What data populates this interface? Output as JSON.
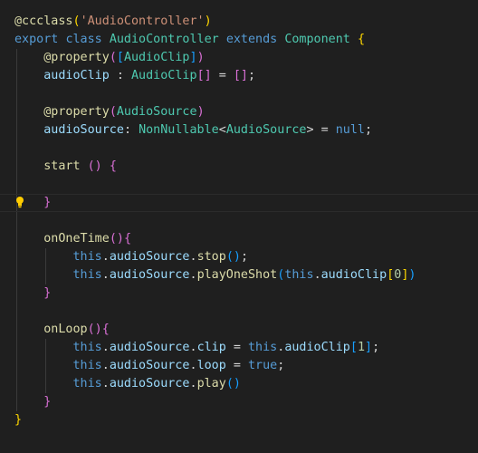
{
  "editor": {
    "colors": {
      "background": "#1f1f1f",
      "keyword": "#569cd6",
      "type": "#4ec9b0",
      "function": "#dcdcaa",
      "variable": "#9cdcfe",
      "string": "#ce9178",
      "number": "#b5cea8",
      "bracket_level1": "#ffd700",
      "bracket_level2": "#da70d6",
      "bracket_level3": "#179fff"
    },
    "lightbulb_icon": "lightbulb-icon",
    "lines": [
      [
        [
          "@ccclass",
          "fn"
        ],
        [
          "(",
          "p1"
        ],
        [
          "'AudioController'",
          "str"
        ],
        [
          ")",
          "p1"
        ]
      ],
      [
        [
          "export ",
          "kw"
        ],
        [
          "class ",
          "kw"
        ],
        [
          "AudioController ",
          "cls"
        ],
        [
          "extends ",
          "kw"
        ],
        [
          "Component ",
          "cls"
        ],
        [
          "{",
          "p1"
        ]
      ],
      [
        [
          "    ",
          "op"
        ],
        [
          "@property",
          "fn"
        ],
        [
          "(",
          "p2"
        ],
        [
          "[",
          "p3"
        ],
        [
          "AudioClip",
          "cls"
        ],
        [
          "]",
          "p3"
        ],
        [
          ")",
          "p2"
        ]
      ],
      [
        [
          "    ",
          "op"
        ],
        [
          "audioClip",
          "var"
        ],
        [
          " : ",
          "op"
        ],
        [
          "AudioClip",
          "cls"
        ],
        [
          "[]",
          "p2"
        ],
        [
          " = ",
          "op"
        ],
        [
          "[]",
          "p2"
        ],
        [
          ";",
          "op"
        ]
      ],
      [],
      [
        [
          "    ",
          "op"
        ],
        [
          "@property",
          "fn"
        ],
        [
          "(",
          "p2"
        ],
        [
          "AudioSource",
          "cls"
        ],
        [
          ")",
          "p2"
        ]
      ],
      [
        [
          "    ",
          "op"
        ],
        [
          "audioSource",
          "var"
        ],
        [
          ": ",
          "op"
        ],
        [
          "NonNullable",
          "cls"
        ],
        [
          "<",
          "op"
        ],
        [
          "AudioSource",
          "cls"
        ],
        [
          "> = ",
          "op"
        ],
        [
          "null",
          "kw"
        ],
        [
          ";",
          "op"
        ]
      ],
      [],
      [
        [
          "    ",
          "op"
        ],
        [
          "start ",
          "fn"
        ],
        [
          "()",
          "p2"
        ],
        [
          " ",
          "op"
        ],
        [
          "{",
          "p2"
        ]
      ],
      [],
      [
        [
          "    ",
          "op"
        ],
        [
          "}",
          "p2"
        ]
      ],
      [],
      [
        [
          "    ",
          "op"
        ],
        [
          "onOneTime",
          "fn"
        ],
        [
          "()",
          "p2"
        ],
        [
          "{",
          "p2"
        ]
      ],
      [
        [
          "        ",
          "op"
        ],
        [
          "this",
          "kw"
        ],
        [
          ".",
          "op"
        ],
        [
          "audioSource",
          "var"
        ],
        [
          ".",
          "op"
        ],
        [
          "stop",
          "fn"
        ],
        [
          "()",
          "p3"
        ],
        [
          ";",
          "op"
        ]
      ],
      [
        [
          "        ",
          "op"
        ],
        [
          "this",
          "kw"
        ],
        [
          ".",
          "op"
        ],
        [
          "audioSource",
          "var"
        ],
        [
          ".",
          "op"
        ],
        [
          "playOneShot",
          "fn"
        ],
        [
          "(",
          "p3"
        ],
        [
          "this",
          "kw"
        ],
        [
          ".",
          "op"
        ],
        [
          "audioClip",
          "var"
        ],
        [
          "[",
          "p1"
        ],
        [
          "0",
          "num"
        ],
        [
          "]",
          "p1"
        ],
        [
          ")",
          "p3"
        ]
      ],
      [
        [
          "    ",
          "op"
        ],
        [
          "}",
          "p2"
        ]
      ],
      [],
      [
        [
          "    ",
          "op"
        ],
        [
          "onLoop",
          "fn"
        ],
        [
          "()",
          "p2"
        ],
        [
          "{",
          "p2"
        ]
      ],
      [
        [
          "        ",
          "op"
        ],
        [
          "this",
          "kw"
        ],
        [
          ".",
          "op"
        ],
        [
          "audioSource",
          "var"
        ],
        [
          ".",
          "op"
        ],
        [
          "clip",
          "var"
        ],
        [
          " = ",
          "op"
        ],
        [
          "this",
          "kw"
        ],
        [
          ".",
          "op"
        ],
        [
          "audioClip",
          "var"
        ],
        [
          "[",
          "p3"
        ],
        [
          "1",
          "num"
        ],
        [
          "]",
          "p3"
        ],
        [
          ";",
          "op"
        ]
      ],
      [
        [
          "        ",
          "op"
        ],
        [
          "this",
          "kw"
        ],
        [
          ".",
          "op"
        ],
        [
          "audioSource",
          "var"
        ],
        [
          ".",
          "op"
        ],
        [
          "loop",
          "var"
        ],
        [
          " = ",
          "op"
        ],
        [
          "true",
          "kw"
        ],
        [
          ";",
          "op"
        ]
      ],
      [
        [
          "        ",
          "op"
        ],
        [
          "this",
          "kw"
        ],
        [
          ".",
          "op"
        ],
        [
          "audioSource",
          "var"
        ],
        [
          ".",
          "op"
        ],
        [
          "play",
          "fn"
        ],
        [
          "()",
          "p3"
        ]
      ],
      [
        [
          "    ",
          "op"
        ],
        [
          "}",
          "p2"
        ]
      ],
      [
        [
          "}",
          "p1"
        ]
      ]
    ]
  }
}
